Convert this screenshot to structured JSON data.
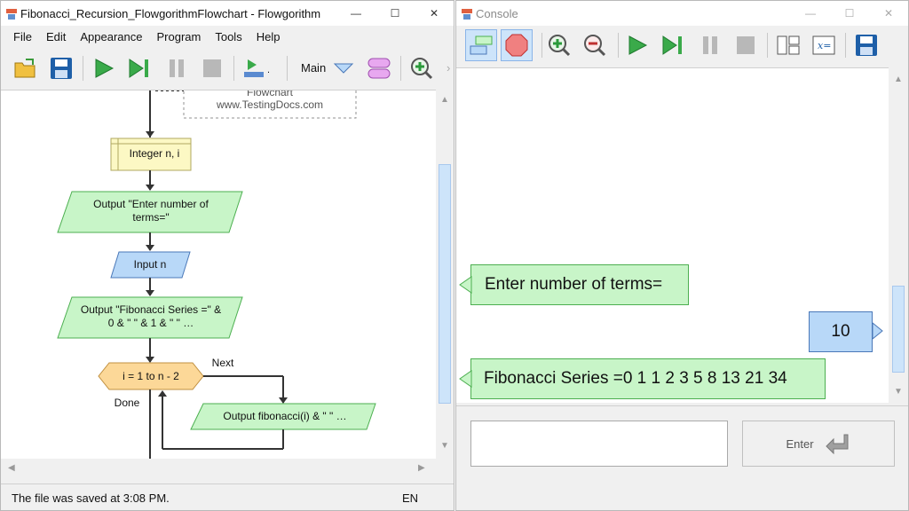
{
  "main_window": {
    "title": "Fibonacci_Recursion_FlowgorithmFlowchart - Flowgorithm",
    "menu": [
      "File",
      "Edit",
      "Appearance",
      "Program",
      "Tools",
      "Help"
    ],
    "toolbar": {
      "icons": [
        "open-folder-icon",
        "save-icon",
        "run-icon",
        "step-icon",
        "pause-icon",
        "stop-icon",
        "layout-icon",
        "function-selector-icon",
        "add-function-icon",
        "zoom-in-icon"
      ],
      "function_label": "Main"
    },
    "flowchart": {
      "comment_line1": "Flowchart",
      "comment_line2": "www.TestingDocs.com",
      "declare": "Integer n, i",
      "output1": "Output \"Enter number of terms=\"",
      "input1": "Input n",
      "output2": "Output \"Fibonacci Series =\" & 0 & \" \" & 1 & \" \" …",
      "loop": "i = 1 to n - 2",
      "loop_next": "Next",
      "loop_done": "Done",
      "output3": "Output fibonacci(i) & \" \" …"
    },
    "status": "The file was saved at 3:08 PM.",
    "language": "EN",
    "colors": {
      "output_fill": "#c8f5c8",
      "input_fill": "#b8d8f8",
      "declare_fill": "#fcf8c4",
      "loop_fill": "#fcd898"
    }
  },
  "console_window": {
    "title": "Console",
    "toolbar_icons": [
      "input-mode-icon",
      "stop-sign-icon",
      "zoom-in-icon",
      "zoom-out-icon",
      "run-icon",
      "step-icon",
      "pause-icon",
      "stop-icon",
      "layout-icon",
      "variables-icon",
      "save-icon"
    ],
    "messages": [
      {
        "type": "output",
        "text": "Enter number of terms="
      },
      {
        "type": "input",
        "text": "10"
      },
      {
        "type": "output",
        "text": "Fibonacci Series =0 1 1 2 3 5 8 13 21 34"
      }
    ],
    "input_value": "",
    "enter_label": "Enter"
  }
}
